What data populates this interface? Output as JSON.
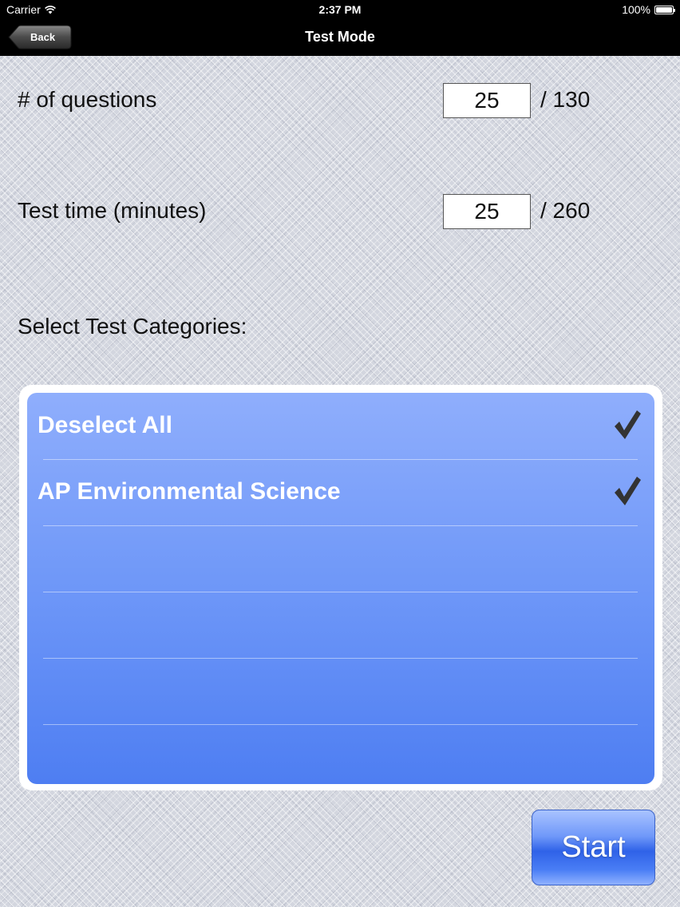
{
  "status_bar": {
    "carrier": "Carrier",
    "time": "2:37 PM",
    "battery": "100%"
  },
  "nav": {
    "back_label": "Back",
    "title": "Test Mode"
  },
  "form": {
    "questions_label": "# of questions",
    "questions_value": "25",
    "questions_max": "/ 130",
    "time_label": "Test time (minutes)",
    "time_value": "25",
    "time_max": "/ 260"
  },
  "categories": {
    "heading": "Select Test Categories:",
    "items": [
      {
        "label": "Deselect All",
        "checked": true
      },
      {
        "label": "AP Environmental Science",
        "checked": true
      }
    ]
  },
  "start_label": "Start",
  "colors": {
    "accent": "#4e7ef2",
    "nav_background": "#000000",
    "check": "#333333"
  },
  "icons": {
    "wifi": "wifi-icon",
    "battery": "battery-icon",
    "back": "back-arrow-button",
    "check": "check-icon"
  }
}
